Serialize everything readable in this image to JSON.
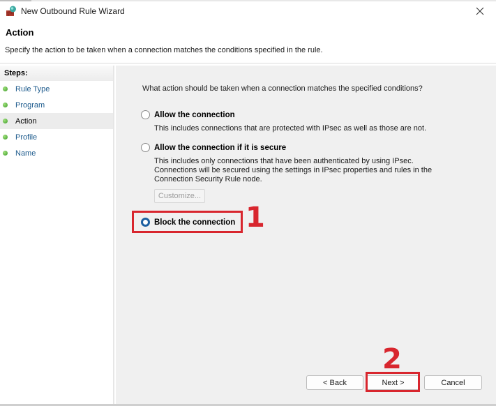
{
  "window": {
    "title": "New Outbound Rule Wizard",
    "close_icon": "close-icon",
    "app_icon": "firewall-icon"
  },
  "header": {
    "title": "Action",
    "description": "Specify the action to be taken when a connection matches the conditions specified in the rule."
  },
  "sidebar": {
    "heading": "Steps:",
    "items": [
      {
        "label": "Rule Type",
        "active": false
      },
      {
        "label": "Program",
        "active": false
      },
      {
        "label": "Action",
        "active": true
      },
      {
        "label": "Profile",
        "active": false
      },
      {
        "label": "Name",
        "active": false
      }
    ]
  },
  "main": {
    "question": "What action should be taken when a connection matches the specified conditions?",
    "options": [
      {
        "label": "Allow the connection",
        "description": "This includes connections that are protected with IPsec as well as those are not.",
        "selected": false
      },
      {
        "label": "Allow the connection if it is secure",
        "description": "This includes only connections that have been authenticated by using IPsec.  Connections will be secured using the settings in IPsec properties and rules in the Connection Security Rule node.",
        "selected": false
      },
      {
        "label": "Block the connection",
        "description": "",
        "selected": true
      }
    ],
    "customize_label": "Customize..."
  },
  "annotations": {
    "step1": "1",
    "step2": "2",
    "highlight_color": "#d8262e"
  },
  "footer": {
    "back_label": "< Back",
    "next_label": "Next >",
    "cancel_label": "Cancel"
  }
}
